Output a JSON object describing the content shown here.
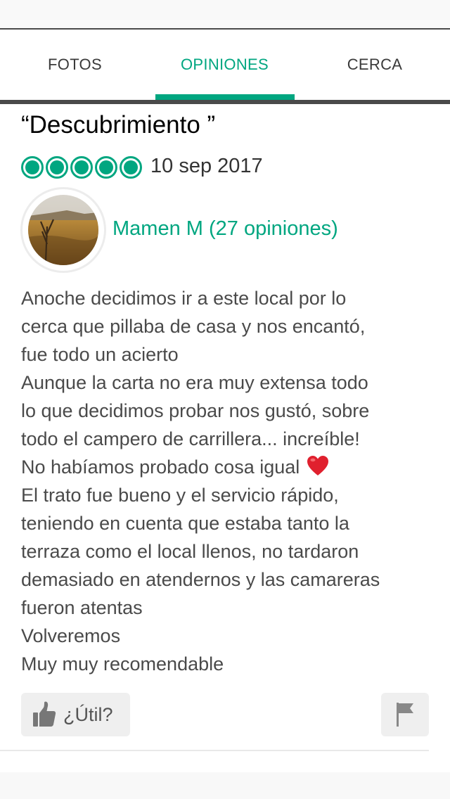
{
  "tabs": [
    {
      "label": "FOTOS",
      "active": false
    },
    {
      "label": "OPINIONES",
      "active": true
    },
    {
      "label": "CERCA",
      "active": false
    }
  ],
  "review": {
    "title": "“Descubrimiento ”",
    "rating": 5,
    "rating_max": 5,
    "date": "10 sep 2017",
    "author": "Mamen M (27 opiniones)",
    "avatar_icon": "landscape-photo",
    "body_lines": [
      "Anoche decidimos ir a este local por lo",
      "cerca que pillaba de casa y nos encantó,",
      "fue todo un acierto",
      "Aunque la carta no era muy extensa todo",
      "lo que decidimos probar nos gustó, sobre",
      "todo el campero de carrillera... increíble!",
      "No habíamos probado cosa igual",
      "El trato fue bueno y el servicio rápido,",
      "teniendo en cuenta que estaba tanto la",
      "terraza como el local llenos, no tardaron",
      "demasiado en atendernos y las camareras",
      "fueron atentas",
      "Volveremos",
      "Muy muy recomendable"
    ],
    "emoji_icon": "red-heart"
  },
  "actions": {
    "helpful_label": "¿Útil?",
    "helpful_icon": "thumbs-up-icon",
    "flag_icon": "flag-icon"
  },
  "colors": {
    "accent": "#00a680",
    "text": "#4a4a4a",
    "rule": "#4a4a4a",
    "button_bg": "#efefef",
    "heart": "#e0202e"
  }
}
